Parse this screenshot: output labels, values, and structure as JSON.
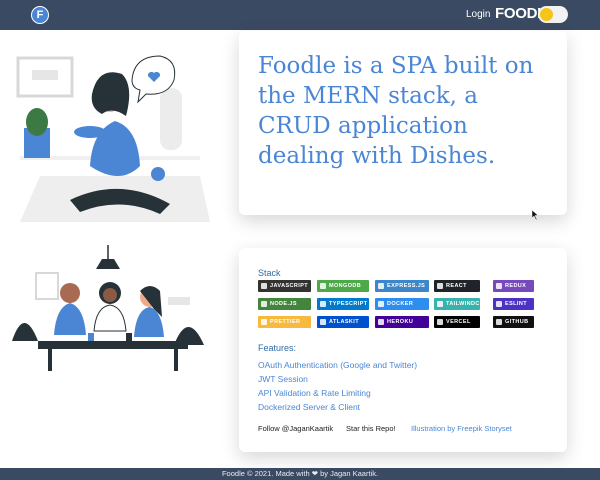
{
  "navbar": {
    "logo_letter": "F",
    "login_label": "Login",
    "brand": "FOODLE"
  },
  "hero": {
    "text": "Foodle is a SPA built on the MERN stack, a CRUD application dealing with Dishes."
  },
  "stack": {
    "title": "Stack",
    "badges": [
      {
        "label": "JAVASCRIPT",
        "color": "#323330"
      },
      {
        "label": "MONGODB",
        "color": "#4ea94b"
      },
      {
        "label": "EXPRESS.JS",
        "color": "#3c86c9"
      },
      {
        "label": "REACT",
        "color": "#20232a"
      },
      {
        "label": "REDUX",
        "color": "#764abc"
      },
      {
        "label": "NODE.JS",
        "color": "#43853d"
      },
      {
        "label": "TYPESCRIPT",
        "color": "#007acc"
      },
      {
        "label": "DOCKER",
        "color": "#2d8ef0"
      },
      {
        "label": "TAILWINDCSS",
        "color": "#38b2ac"
      },
      {
        "label": "ESLINT",
        "color": "#4b32c3"
      },
      {
        "label": "PRETTIER",
        "color": "#f7b93e"
      },
      {
        "label": "ATLASKIT",
        "color": "#0052cc"
      },
      {
        "label": "HEROKU",
        "color": "#430098"
      },
      {
        "label": "VERCEL",
        "color": "#000000"
      },
      {
        "label": "GITHUB",
        "color": "#121011"
      }
    ]
  },
  "features": {
    "title": "Features:",
    "items": [
      "OAuth Authentication (Google and Twitter)",
      "JWT Session",
      "API Validation & Rate Limiting",
      "Dockerized Server & Client"
    ]
  },
  "links": {
    "follow": "Follow @JaganKaartik",
    "star": "Star this Repo!",
    "illustration": "Illustration by Freepik Storyset"
  },
  "footer": {
    "text": "Foodle © 2021. Made with ❤ by Jagan Kaartik."
  },
  "colors": {
    "navbar": "#3b4a63",
    "accent": "#4a86d4",
    "toggle_knob": "#f5c518"
  }
}
